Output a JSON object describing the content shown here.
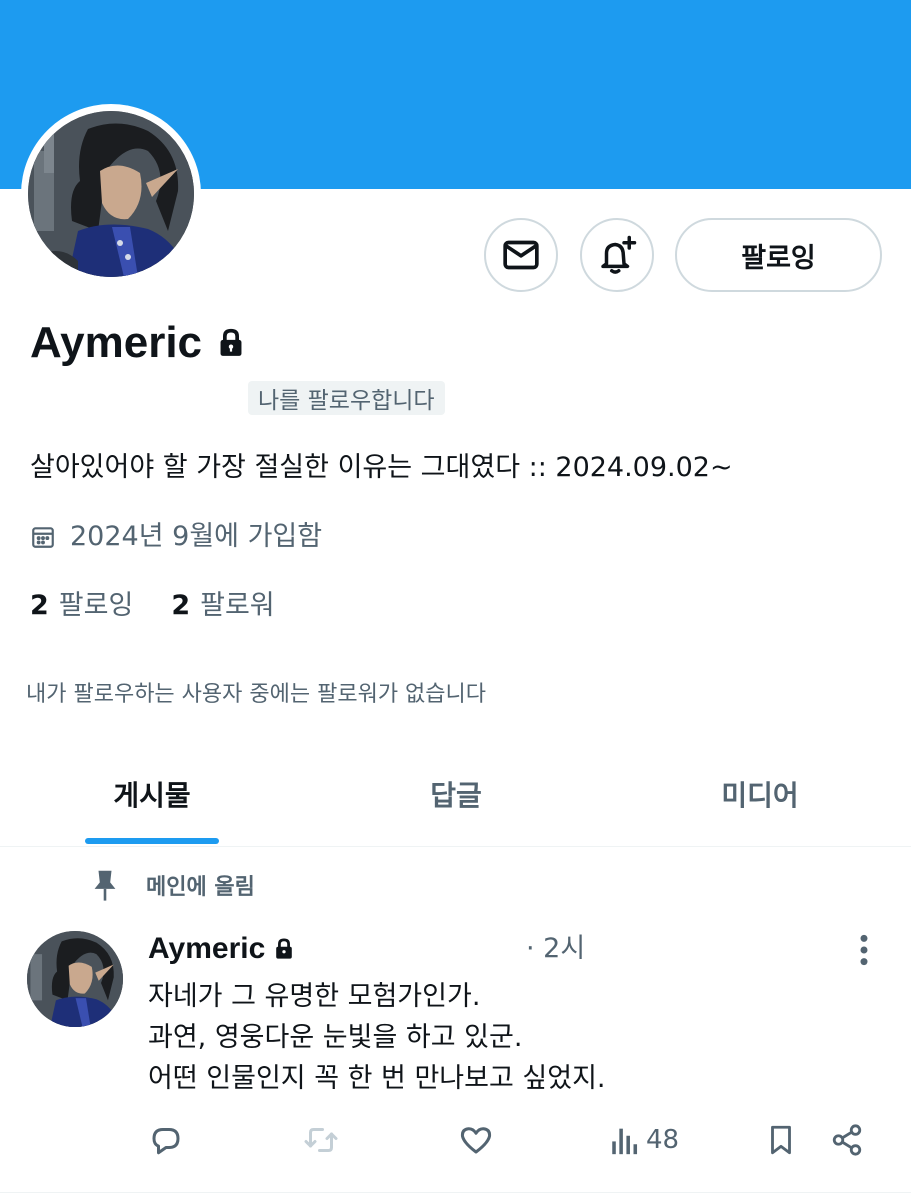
{
  "profile": {
    "display_name": "Aymeric",
    "follows_you": "나를 팔로우합니다",
    "bio": "살아있어야 할 가장 절실한 이유는 그대였다 :: 2024.09.02~",
    "joined": "2024년 9월에 가입함",
    "following_count": "2",
    "following_label": "팔로잉",
    "followers_count": "2",
    "followers_label": "팔로워",
    "no_known_followers": "내가 팔로우하는 사용자 중에는 팔로워가 없습니다"
  },
  "actions": {
    "follow_label": "팔로잉",
    "message_icon": "envelope-icon",
    "notify_icon": "bell-plus-icon"
  },
  "tabs": [
    {
      "label": "게시물",
      "active": true
    },
    {
      "label": "답글",
      "active": false
    },
    {
      "label": "미디어",
      "active": false
    }
  ],
  "pinned_post": {
    "pinned_label": "메인에 올림",
    "author": "Aymeric",
    "time": "· 2시",
    "lines": [
      "자네가 그 유명한 모험가인가.",
      "과연, 영웅다운 눈빛을 하고 있군.",
      "어떤 인물인지 꼭 한 번 만나보고 싶었지."
    ],
    "views": "48"
  },
  "colors": {
    "accent": "#1d9bf0",
    "text_primary": "#0f1419",
    "text_secondary": "#536471"
  }
}
